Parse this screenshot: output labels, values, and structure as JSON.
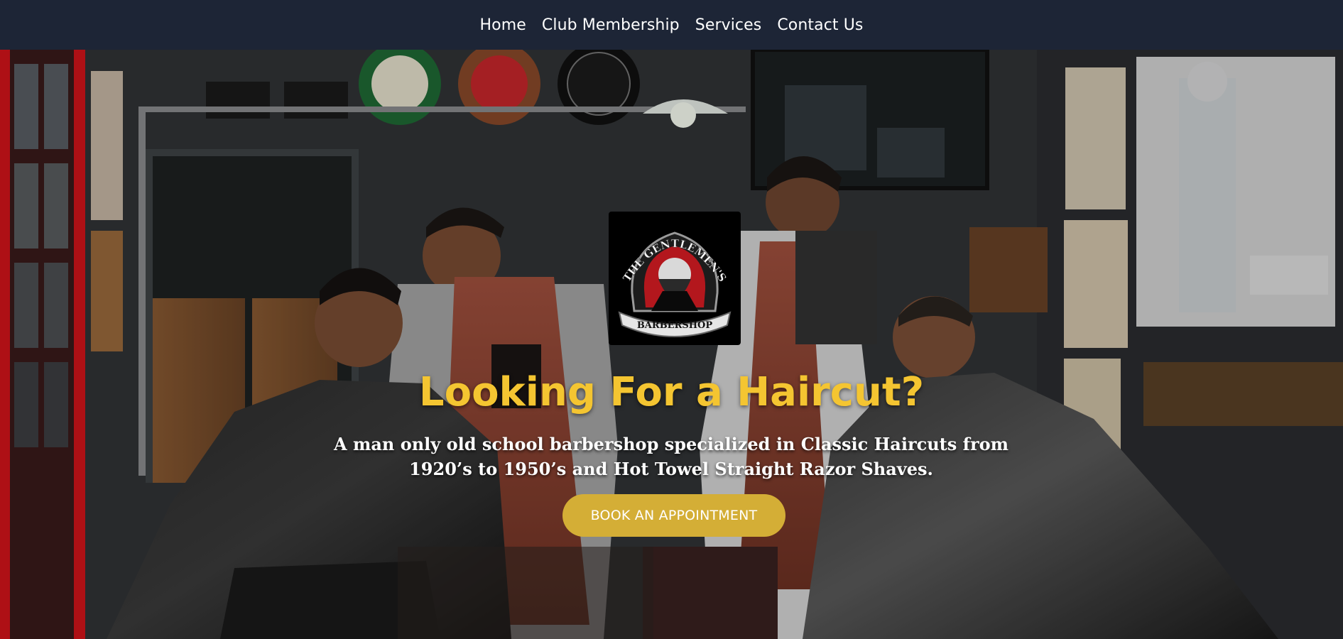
{
  "nav": {
    "items": [
      {
        "label": "Home"
      },
      {
        "label": "Club Membership"
      },
      {
        "label": "Services"
      },
      {
        "label": "Contact Us"
      }
    ]
  },
  "hero": {
    "logo": {
      "text_top": "THE GENTLEMEN'S",
      "text_bottom": "BARBERSHOP"
    },
    "headline": "Looking For a Haircut?",
    "subtext": "A man only old school barbershop specialized in Classic Haircuts from 1920’s to 1950’s and Hot Towel Straight Razor Shaves.",
    "cta_label": "BOOK AN APPOINTMENT"
  },
  "colors": {
    "nav_background": "#1d2536",
    "headline": "#f4c531",
    "cta_background": "#d4ae36"
  }
}
